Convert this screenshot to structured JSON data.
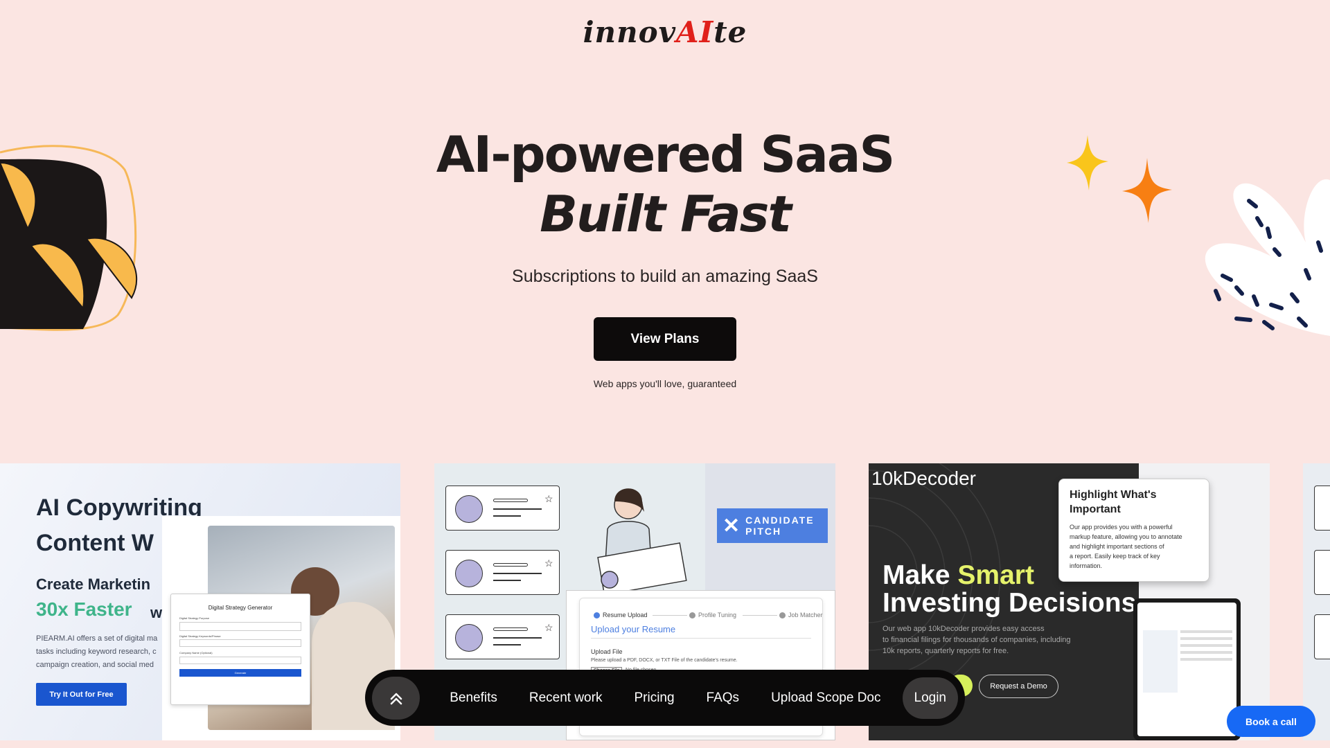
{
  "logo": {
    "part1": "innov",
    "part2": "AI",
    "part3": "te"
  },
  "hero": {
    "title": "AI-powered SaaS",
    "subtitle": "Built Fast",
    "tagline": "Subscriptions to build an amazing SaaS",
    "cta_label": "View Plans",
    "note": "Web apps you'll love, guaranteed"
  },
  "work": {
    "card1": {
      "heading_line1": "AI Copywriting",
      "heading_line2": "Content W",
      "sub_line1": "Create Marketin",
      "sub_line2a": "30x Faster",
      "sub_line2b": "w",
      "para_line1": "PIEARM.AI offers a set of digital ma",
      "para_line2": "tasks including keyword research, c",
      "para_line3": "campaign creation, and social med",
      "button": "Try It Out for Free",
      "form_title": "Digital Strategy Generator",
      "form_label1": "Digital Strategy Purpose",
      "form_label2": "Digital Strategy Keywords/Phrase",
      "form_label3": "Company Name (Optional)",
      "form_button": "Generate"
    },
    "card2": {
      "badge_line1": "CANDIDATE",
      "badge_line2": "PITCH",
      "step1": "Resume Upload",
      "step2": "Profile Tuning",
      "step3": "Job Matcher",
      "upload_title": "Upload your Resume",
      "upload_label": "Upload File",
      "upload_help": "Please upload a PDF, DOCX, or TXT File of the candidate's resume.",
      "choose_file": "Choose File",
      "no_file": "No file chosen"
    },
    "card3": {
      "brand": "10kDecoder",
      "headline_a": "Make ",
      "headline_b": "Smart",
      "headline_line2": "Investing Decisions",
      "desc_line1": "Our web app 10kDecoder provides easy access",
      "desc_line2": "to financial filings for thousands of companies, including",
      "desc_line3": "10k reports, quarterly reports for free.",
      "demo_button": "Request a Demo",
      "popup_title_line1": "Highlight What's",
      "popup_title_line2": "Important",
      "popup_body_line1": "Our app provides you with a powerful",
      "popup_body_line2": "markup feature, allowing you to annotate",
      "popup_body_line3": "and highlight important sections of",
      "popup_body_line4": "a report. Easily keep track of key",
      "popup_body_line5": "information."
    }
  },
  "nav": {
    "items": [
      "Benefits",
      "Recent work",
      "Pricing",
      "FAQs",
      "Upload Scope Doc"
    ],
    "login": "Login"
  },
  "book_call": "Book a call",
  "colors": {
    "background": "#fbe5e2",
    "accent_red": "#e0201a",
    "button_blue": "#1769f5",
    "smart_yellow": "#e5f26b"
  }
}
